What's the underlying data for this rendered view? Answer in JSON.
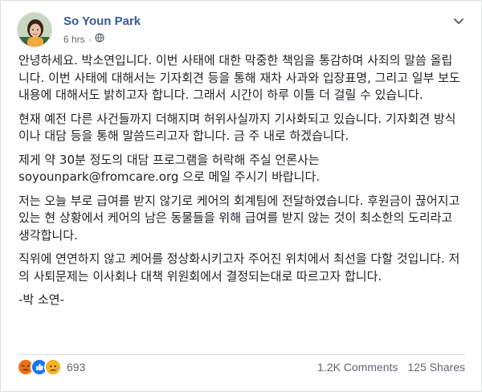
{
  "post": {
    "author": "So Youn Park",
    "time": "6 hrs",
    "privacy_icon": "globe-icon",
    "paragraphs": [
      "안녕하세요. 박소연입니다. 이번 사태에 대한 막중한 책임을 통감하며 사죄의 말씀 올립니다. 이번 사태에 대해서는 기자회견 등을 통해 재차 사과와 입장표명, 그리고 일부 보도내용에 대해서도 밝히고자 합니다. 그래서 시간이 하루 이틀 더 걸릴 수 있습니다.",
      "현재 예전 다른 사건들까지 더해지며 허위사실까지 기사화되고 있습니다. 기자회견 방식이나 대담 등을 통해 말씀드리고자 합니다. 금 주 내로 하겠습니다.",
      "제게 약 30분 정도의 대담 프로그램을 허락해 주실 언론사는 soyounpark@fromcare.org 으로 메일 주시기 바랍니다.",
      "저는 오늘 부로 급여를 받지 않기로 케어의 회계팀에 전달하였습니다. 후원금이 끊어지고 있는 현 상황에서 케어의 남은 동물들을 위해 급여를 받지 않는 것이 최소한의 도리라고 생각합니다.",
      "직위에 연연하지 않고 케어를 정상화시키고자 주어진 위치에서 최선을 다할 것입니다. 저의 사퇴문제는 이사회나 대책 위원회에서 결정되는대로 따르고자 합니다.",
      "-박 소연-"
    ]
  },
  "stats": {
    "reaction_icons": [
      "angry-icon",
      "like-icon",
      "sad-icon"
    ],
    "reaction_count": "693",
    "comments": "1.2K Comments",
    "shares": "125 Shares"
  },
  "colors": {
    "author": "#385898",
    "meta": "#606770",
    "text": "#1d2129",
    "like": "#1877f2",
    "angry": "#e9710f",
    "sad": "#f7b125"
  }
}
